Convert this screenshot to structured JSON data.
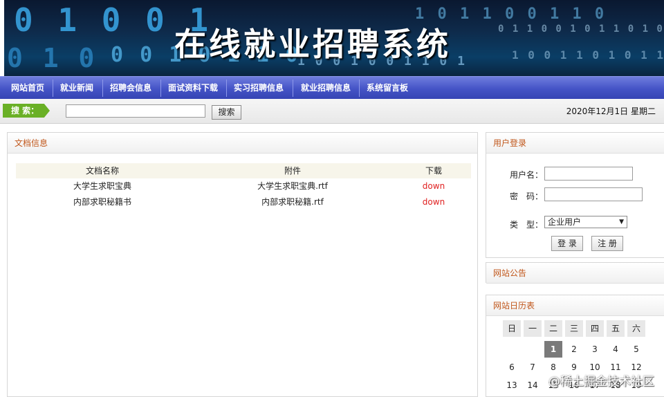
{
  "banner": {
    "title": "在线就业招聘系统"
  },
  "nav": {
    "items": [
      "网站首页",
      "就业新闻",
      "招聘会信息",
      "面试资料下载",
      "实习招聘信息",
      "就业招聘信息",
      "系统留言板"
    ]
  },
  "search": {
    "label": "搜 索：",
    "input_value": "",
    "button": "搜索",
    "date": "2020年12月1日 星期二"
  },
  "docs": {
    "title": "文档信息",
    "columns": [
      "文档名称",
      "附件",
      "下载"
    ],
    "rows": [
      {
        "name": "大学生求职宝典",
        "file": "大学生求职宝典.rtf",
        "action": "down"
      },
      {
        "name": "内部求职秘籍书",
        "file": "内部求职秘籍.rtf",
        "action": "down"
      }
    ]
  },
  "login": {
    "title": "用户登录",
    "username_label": "用户名：",
    "password_label": "密　码：",
    "type_label": "类　型：",
    "type_selected": "企业用户",
    "login_button": "登 录",
    "register_button": "注 册"
  },
  "notice": {
    "title": "网站公告"
  },
  "calendar": {
    "title": "网站日历表",
    "weekdays": [
      "日",
      "一",
      "二",
      "三",
      "四",
      "五",
      "六"
    ],
    "weeks": [
      [
        "",
        "",
        "1",
        "2",
        "3",
        "4",
        "5"
      ],
      [
        "6",
        "7",
        "8",
        "9",
        "10",
        "11",
        "12"
      ],
      [
        "13",
        "14",
        "15",
        "16",
        "17",
        "18",
        "19"
      ]
    ],
    "today": "1"
  },
  "watermark": "@稀土掘金技术社区",
  "colors": {
    "nav_bg": "#4453c6",
    "accent_text": "#c0561a",
    "download": "#e02020",
    "search_tag": "#6ab026"
  }
}
